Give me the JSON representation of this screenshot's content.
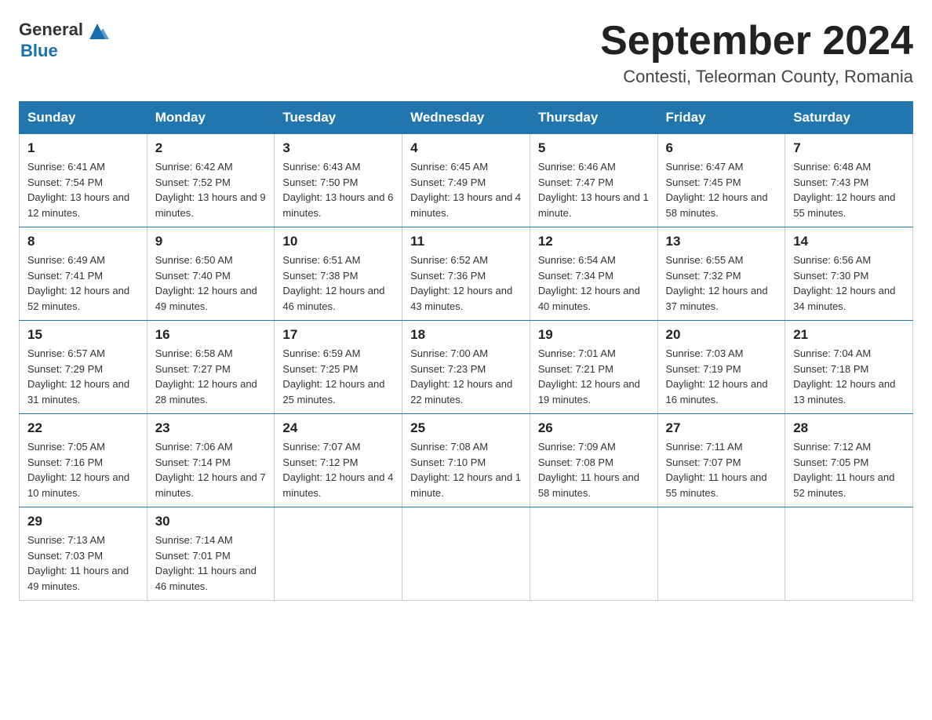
{
  "header": {
    "logo_general": "General",
    "logo_blue": "Blue",
    "month_title": "September 2024",
    "location": "Contesti, Teleorman County, Romania"
  },
  "weekdays": [
    "Sunday",
    "Monday",
    "Tuesday",
    "Wednesday",
    "Thursday",
    "Friday",
    "Saturday"
  ],
  "weeks": [
    [
      {
        "day": "1",
        "sunrise": "6:41 AM",
        "sunset": "7:54 PM",
        "daylight": "13 hours and 12 minutes."
      },
      {
        "day": "2",
        "sunrise": "6:42 AM",
        "sunset": "7:52 PM",
        "daylight": "13 hours and 9 minutes."
      },
      {
        "day": "3",
        "sunrise": "6:43 AM",
        "sunset": "7:50 PM",
        "daylight": "13 hours and 6 minutes."
      },
      {
        "day": "4",
        "sunrise": "6:45 AM",
        "sunset": "7:49 PM",
        "daylight": "13 hours and 4 minutes."
      },
      {
        "day": "5",
        "sunrise": "6:46 AM",
        "sunset": "7:47 PM",
        "daylight": "13 hours and 1 minute."
      },
      {
        "day": "6",
        "sunrise": "6:47 AM",
        "sunset": "7:45 PM",
        "daylight": "12 hours and 58 minutes."
      },
      {
        "day": "7",
        "sunrise": "6:48 AM",
        "sunset": "7:43 PM",
        "daylight": "12 hours and 55 minutes."
      }
    ],
    [
      {
        "day": "8",
        "sunrise": "6:49 AM",
        "sunset": "7:41 PM",
        "daylight": "12 hours and 52 minutes."
      },
      {
        "day": "9",
        "sunrise": "6:50 AM",
        "sunset": "7:40 PM",
        "daylight": "12 hours and 49 minutes."
      },
      {
        "day": "10",
        "sunrise": "6:51 AM",
        "sunset": "7:38 PM",
        "daylight": "12 hours and 46 minutes."
      },
      {
        "day": "11",
        "sunrise": "6:52 AM",
        "sunset": "7:36 PM",
        "daylight": "12 hours and 43 minutes."
      },
      {
        "day": "12",
        "sunrise": "6:54 AM",
        "sunset": "7:34 PM",
        "daylight": "12 hours and 40 minutes."
      },
      {
        "day": "13",
        "sunrise": "6:55 AM",
        "sunset": "7:32 PM",
        "daylight": "12 hours and 37 minutes."
      },
      {
        "day": "14",
        "sunrise": "6:56 AM",
        "sunset": "7:30 PM",
        "daylight": "12 hours and 34 minutes."
      }
    ],
    [
      {
        "day": "15",
        "sunrise": "6:57 AM",
        "sunset": "7:29 PM",
        "daylight": "12 hours and 31 minutes."
      },
      {
        "day": "16",
        "sunrise": "6:58 AM",
        "sunset": "7:27 PM",
        "daylight": "12 hours and 28 minutes."
      },
      {
        "day": "17",
        "sunrise": "6:59 AM",
        "sunset": "7:25 PM",
        "daylight": "12 hours and 25 minutes."
      },
      {
        "day": "18",
        "sunrise": "7:00 AM",
        "sunset": "7:23 PM",
        "daylight": "12 hours and 22 minutes."
      },
      {
        "day": "19",
        "sunrise": "7:01 AM",
        "sunset": "7:21 PM",
        "daylight": "12 hours and 19 minutes."
      },
      {
        "day": "20",
        "sunrise": "7:03 AM",
        "sunset": "7:19 PM",
        "daylight": "12 hours and 16 minutes."
      },
      {
        "day": "21",
        "sunrise": "7:04 AM",
        "sunset": "7:18 PM",
        "daylight": "12 hours and 13 minutes."
      }
    ],
    [
      {
        "day": "22",
        "sunrise": "7:05 AM",
        "sunset": "7:16 PM",
        "daylight": "12 hours and 10 minutes."
      },
      {
        "day": "23",
        "sunrise": "7:06 AM",
        "sunset": "7:14 PM",
        "daylight": "12 hours and 7 minutes."
      },
      {
        "day": "24",
        "sunrise": "7:07 AM",
        "sunset": "7:12 PM",
        "daylight": "12 hours and 4 minutes."
      },
      {
        "day": "25",
        "sunrise": "7:08 AM",
        "sunset": "7:10 PM",
        "daylight": "12 hours and 1 minute."
      },
      {
        "day": "26",
        "sunrise": "7:09 AM",
        "sunset": "7:08 PM",
        "daylight": "11 hours and 58 minutes."
      },
      {
        "day": "27",
        "sunrise": "7:11 AM",
        "sunset": "7:07 PM",
        "daylight": "11 hours and 55 minutes."
      },
      {
        "day": "28",
        "sunrise": "7:12 AM",
        "sunset": "7:05 PM",
        "daylight": "11 hours and 52 minutes."
      }
    ],
    [
      {
        "day": "29",
        "sunrise": "7:13 AM",
        "sunset": "7:03 PM",
        "daylight": "11 hours and 49 minutes."
      },
      {
        "day": "30",
        "sunrise": "7:14 AM",
        "sunset": "7:01 PM",
        "daylight": "11 hours and 46 minutes."
      },
      null,
      null,
      null,
      null,
      null
    ]
  ]
}
